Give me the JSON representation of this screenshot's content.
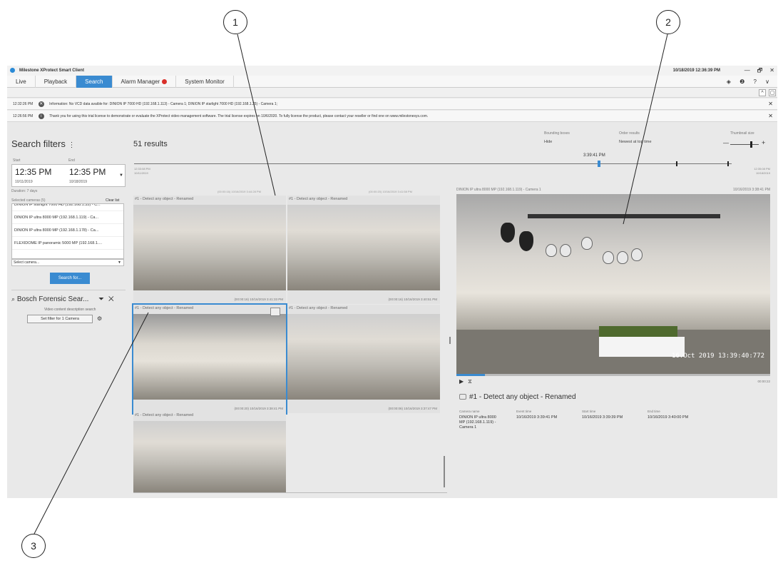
{
  "app": {
    "title": "Milestone XProtect Smart Client",
    "clock": "10/18/2019 12:36:39 PM",
    "window_buttons": [
      "—",
      "🗗",
      "✕"
    ]
  },
  "tabs": [
    {
      "label": "Live"
    },
    {
      "label": "Playback"
    },
    {
      "label": "Search"
    },
    {
      "label": "Alarm Manager"
    },
    {
      "label": "System Monitor"
    }
  ],
  "top_icons": "◈ ❷ ? ∨",
  "messages": [
    {
      "time": "12:32:26 PM",
      "text": "Information: No VCD data avaible for: DINION IP 7000 HD (192.168.1.113) - Camera 1; DINION IP starlight 7000 HD (192.168.1.35) - Camera 1;"
    },
    {
      "time": "12:26:56 PM",
      "text": "Thank you for using this trial license to demonstrate or evaluate the XProtect video management software. The trial license expires on 10/6/2020. To fully license the product, please contact your reseller or find one on www.milestonesys.com."
    }
  ],
  "filters": {
    "title": "Search filters",
    "start_label": "Start",
    "end_label": "End",
    "start_time": "12:35 PM",
    "start_date": "10/11/2019",
    "end_time": "12:35 PM",
    "end_date": "10/18/2019",
    "duration": "Duration: 7 days",
    "selected_cameras": "Selected cameras (5)",
    "clear_list": "Clear list",
    "cameras": [
      "DINION IP starlight 7000 HD (192.168.1.35) - C...",
      "DINION IP ultra 8000 MP (192.168.1.119) - Ca...",
      "DINION IP ultra 8000 MP (192.168.1.178) - Ca...",
      "FLEXIDOME IP panoramic 5000 MP (192.168.1...."
    ],
    "select_camera": "Select camera...",
    "search_button": "Search for...",
    "bosch_title": "Bosch Forensic Sear...",
    "vcd_text": "Video content description search",
    "set_filter": "Set filter for 1 Camera"
  },
  "results": {
    "title": "51 results",
    "timeline_time": "3:39:41 PM",
    "timeline_left": "12:33:08 PM\n10/11/2019",
    "timeline_right": "12:35:08 PM\n10/18/2019",
    "bounding_label": "Bounding boxes",
    "bounding_value": "Hide",
    "order_label": "Order results",
    "order_value": "Newest at top time",
    "thumb_label": "Thumbnail size",
    "partial_left": "(00:00:16)   10/16/2019 3:44:28 PM",
    "partial_right": "(00:00:20)   10/16/2019 3:41:58 PM",
    "cards": [
      {
        "title": "#1 - Detect any object - Renamed",
        "ts": "(00:00:16)   10/16/2019 3:41:33 PM"
      },
      {
        "title": "#1 - Detect any object - Renamed",
        "ts": "(00:00:16)   10/16/2019 3:40:51 PM"
      },
      {
        "title": "#1 - Detect any object - Renamed",
        "ts": "(00:00:20)   10/16/2019 3:38:41 PM"
      },
      {
        "title": "#1 - Detect any object - Renamed",
        "ts": "(00:00:06)   10/16/2019 3:37:47 PM"
      },
      {
        "title": "#1 - Detect any object - Renamed",
        "ts": ""
      }
    ]
  },
  "preview": {
    "camera": "DINION IP ultra 8000 MP (192.168.1.119) - Camera 1",
    "datetime": "10/16/2019 3:38:41 PM",
    "stamp": "16.Oct 2019  13:39:40:772",
    "progress": 0.09,
    "duration": "00:00:22",
    "title": "#1 - Detect any object - Renamed",
    "camera_name_label": "Camera name",
    "camera_name": "DINION IP ultra 8000\nMP (192.168.1.119) -\nCamera 1",
    "event_time_label": "Event time",
    "event_time": "10/16/2019 3:39:41 PM",
    "start_time_label": "Start time",
    "start_time": "10/16/2019 3:39:39 PM",
    "end_time_label": "End time",
    "end_time": "10/16/2019 3:40:00 PM"
  },
  "callouts": [
    "1",
    "2",
    "3"
  ]
}
